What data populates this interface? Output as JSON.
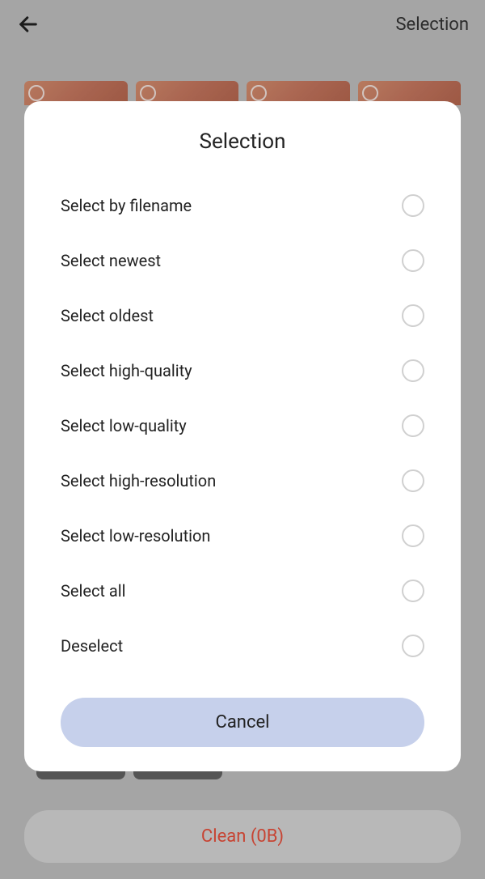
{
  "header": {
    "title": "Selection"
  },
  "modal": {
    "title": "Selection",
    "options": [
      {
        "label": "Select by filename"
      },
      {
        "label": "Select newest"
      },
      {
        "label": "Select oldest"
      },
      {
        "label": "Select high-quality"
      },
      {
        "label": "Select low-quality"
      },
      {
        "label": "Select high-resolution"
      },
      {
        "label": "Select low-resolution"
      },
      {
        "label": "Select all"
      },
      {
        "label": "Deselect"
      }
    ],
    "cancel_label": "Cancel"
  },
  "footer": {
    "clean_label": "Clean (0B)"
  }
}
